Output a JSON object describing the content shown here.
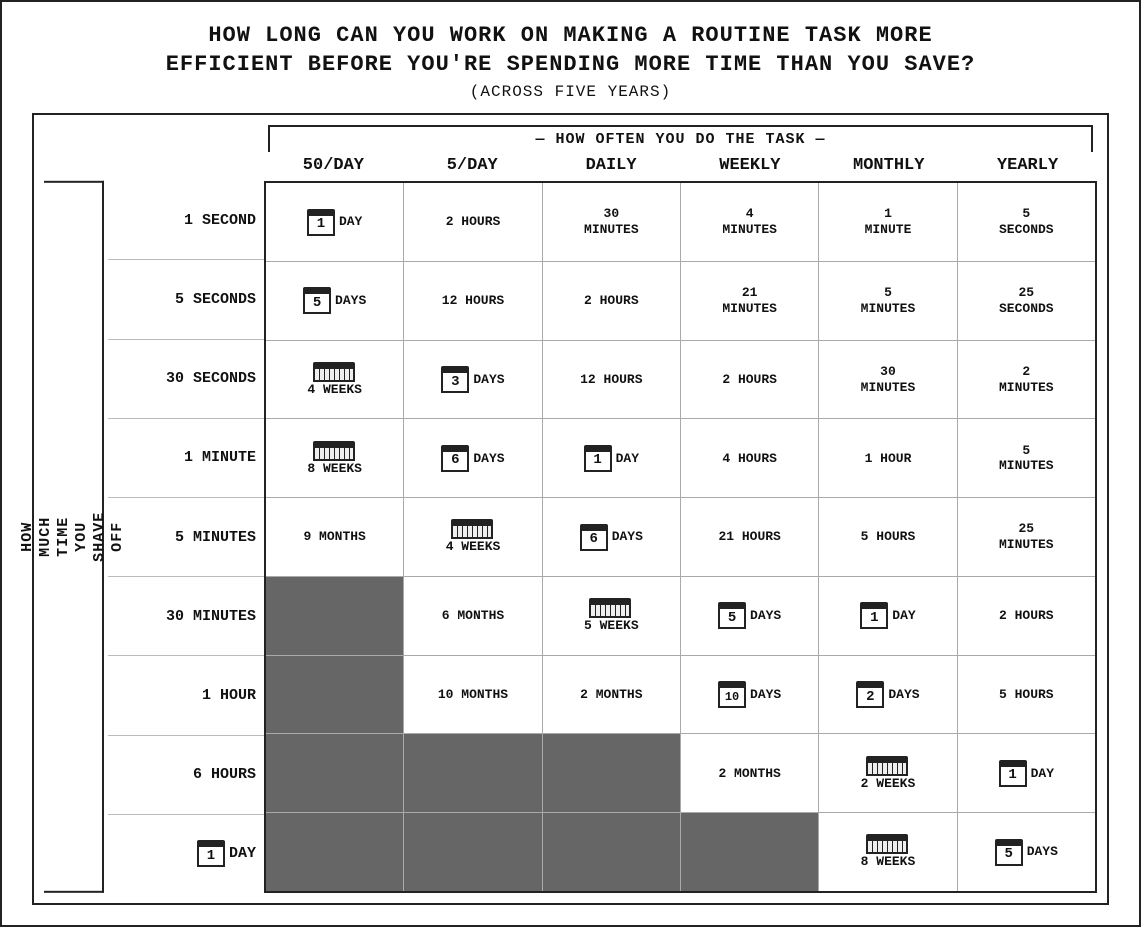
{
  "title": {
    "line1": "How long can you work on making a routine task more",
    "line2": "efficient before you're spending more time than you save?",
    "subtitle": "(Across Five Years)"
  },
  "how_often_label": "How Often You Do the Task",
  "col_headers": [
    "50/Day",
    "5/Day",
    "Daily",
    "Weekly",
    "Monthly",
    "Yearly"
  ],
  "row_header_label": "How\nMuch\nTime\nYou\nShave\nOff",
  "row_labels": [
    "1 Second",
    "5 Seconds",
    "30 Seconds",
    "1 Minute",
    "5 Minutes",
    "30 Minutes",
    "1 Hour",
    "6 Hours",
    "1 Day"
  ],
  "cells": [
    [
      "1day_cal",
      "2 Hours",
      "30\nMinutes",
      "4\nMinutes",
      "1\nMinute",
      "5\nSeconds"
    ],
    [
      "5days_cal",
      "12 Hours",
      "2 Hours",
      "21\nMinutes",
      "5\nMinutes",
      "25\nSeconds"
    ],
    [
      "4weeks_bar",
      "3days_cal",
      "12 Hours",
      "2 Hours",
      "30\nMinutes",
      "2\nMinutes"
    ],
    [
      "8weeks_bar",
      "6days_cal",
      "1day_cal2",
      "4 Hours",
      "1 Hour",
      "5\nMinutes"
    ],
    [
      "9months_text",
      "4weeks_bar2",
      "6days_cal2",
      "21 Hours",
      "5 Hours",
      "25\nMinutes"
    ],
    [
      "dark",
      "6 Months",
      "5weeks_bar",
      "5days_cal2",
      "1day_cal3",
      "2 Hours"
    ],
    [
      "dark",
      "10 Months",
      "2 Months",
      "10days_cal",
      "2days_cal",
      "5 Hours"
    ],
    [
      "dark",
      "dark",
      "dark",
      "2 Months",
      "2weeks_bar",
      "1day_cal4"
    ],
    [
      "dark",
      "dark",
      "dark",
      "dark",
      "8weeks_bar2",
      "5days_cal3"
    ]
  ]
}
